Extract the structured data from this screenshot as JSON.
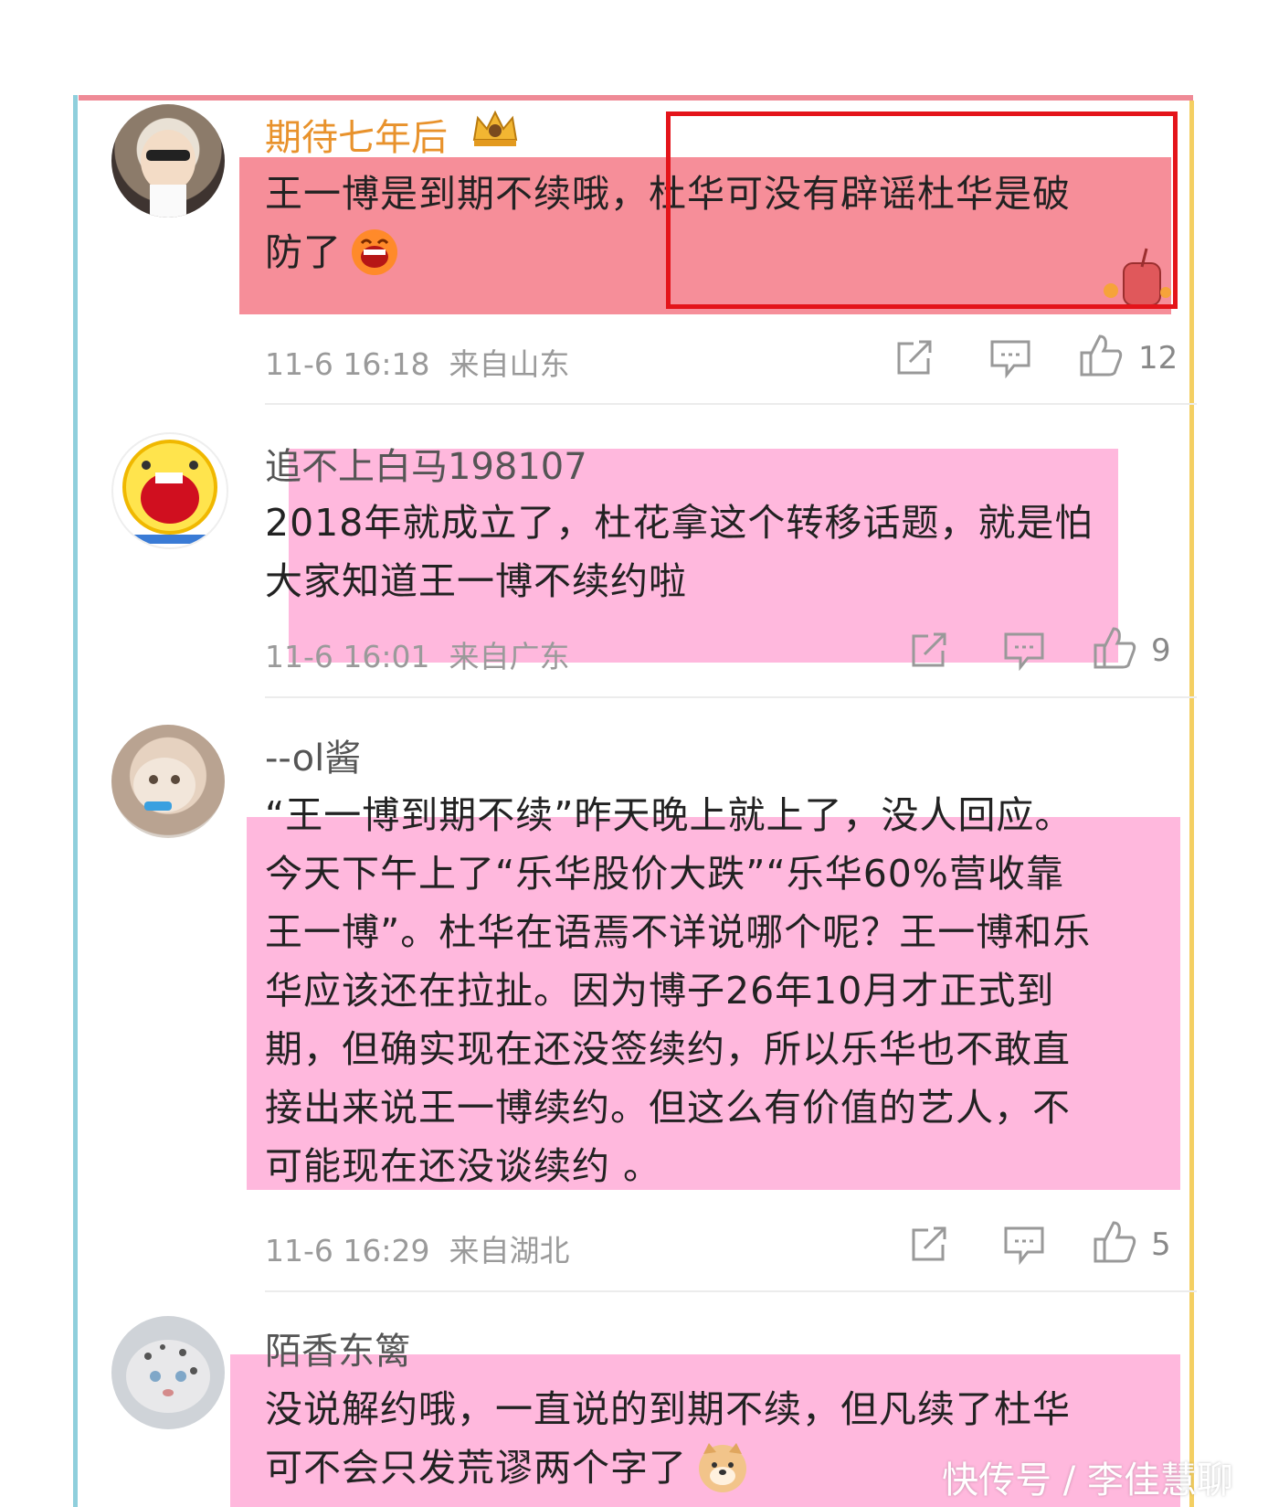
{
  "comments": [
    {
      "username": "期待七年后",
      "lines": [
        "王一博是到期不续哦，杜华可没有辟谣杜华是破",
        "防了"
      ],
      "time": "11-6 16:18",
      "location": "来自山东",
      "likes": "12"
    },
    {
      "username": "追不上白马198107",
      "lines": [
        "2018年就成立了，杜花拿这个转移话题，就是怕",
        "大家知道王一博不续约啦"
      ],
      "time": "11-6 16:01",
      "location": "来自广东",
      "likes": "9"
    },
    {
      "username": "--ol酱",
      "lines": [
        "“王一博到期不续”昨天晚上就上了，没人回应。",
        "今天下午上了“乐华股价大跌”“乐华60%营收靠",
        "王一博”。杜华在语焉不详说哪个呢？王一博和乐",
        "华应该还在拉扯。因为博子26年10月才正式到",
        "期，但确实现在还没签续约，所以乐华也不敢直",
        "接出来说王一博续约。但这么有价值的艺人，不",
        "可能现在还没谈续约 。"
      ],
      "time": "11-6 16:29",
      "location": "来自湖北",
      "likes": "5"
    },
    {
      "username": "陌香东篱",
      "lines": [
        "没说解约哦，一直说的到期不续，但凡续了杜华",
        "可不会只发荒谬两个字了"
      ]
    }
  ],
  "watermark": "快传号 / 李佳慧聊",
  "colors": {
    "accent_highlight": "#f46e7c",
    "pink_highlight": "#ffa8d6",
    "red_box": "#e4141a",
    "username_gold": "#e8922c"
  }
}
